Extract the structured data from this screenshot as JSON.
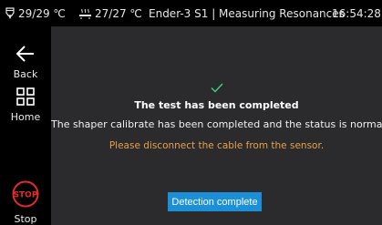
{
  "status_bar": {
    "nozzle_temp": "29/29 ℃",
    "bed_temp": "27/27 ℃",
    "title": "Ender-3 S1 | Measuring Resonances",
    "time": "16:54:28"
  },
  "sidebar": {
    "back_label": "Back",
    "home_label": "Home",
    "stop_label": "Stop",
    "stop_icon_text": "STOP"
  },
  "dialog": {
    "title": "The test has been completed",
    "message": "The shaper calibrate has been completed and the status is normal.",
    "warning": "Please disconnect the cable from the sensor.",
    "button_label": "Detection complete"
  },
  "colors": {
    "panel": "#2b2b2d",
    "accent_blue": "#1b90d8",
    "warning_orange": "#e8a04a",
    "check_green": "#3fd08a",
    "stop_red": "#e32b2b"
  }
}
